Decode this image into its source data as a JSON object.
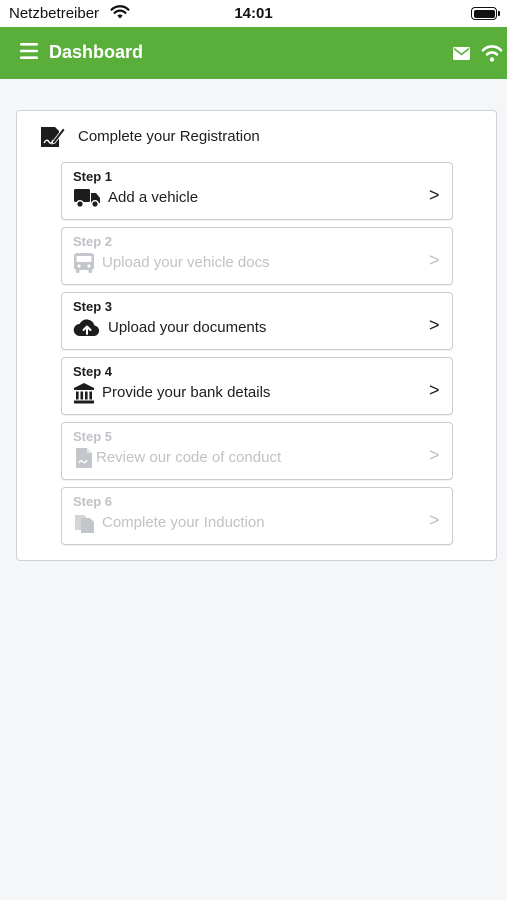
{
  "status_bar": {
    "carrier": "Netzbetreiber",
    "time": "14:01"
  },
  "app_bar": {
    "title": "Dashboard",
    "icons": [
      "menu-icon",
      "mail-icon",
      "wifi-icon"
    ]
  },
  "registration": {
    "title": "Complete your Registration",
    "icon": "signature-document-icon",
    "steps": [
      {
        "label": "Step 1",
        "text": "Add a vehicle",
        "icon": "truck-icon",
        "enabled": true,
        "chevron": ">"
      },
      {
        "label": "Step 2",
        "text": "Upload your vehicle docs",
        "icon": "bus-icon",
        "enabled": false,
        "chevron": ">"
      },
      {
        "label": "Step 3",
        "text": "Upload your documents",
        "icon": "cloud-upload-icon",
        "enabled": true,
        "chevron": ">"
      },
      {
        "label": "Step 4",
        "text": "Provide your bank details",
        "icon": "bank-icon",
        "enabled": true,
        "chevron": ">"
      },
      {
        "label": "Step 5",
        "text": "Review our code of conduct",
        "icon": "document-icon",
        "enabled": false,
        "chevron": ">"
      },
      {
        "label": "Step 6",
        "text": "Complete your Induction",
        "icon": "copy-documents-icon",
        "enabled": false,
        "chevron": ">"
      }
    ]
  },
  "colors": {
    "brand_green": "#5aaf3b",
    "active_text": "#1d1d1d",
    "disabled_text": "#bfc2c6"
  }
}
